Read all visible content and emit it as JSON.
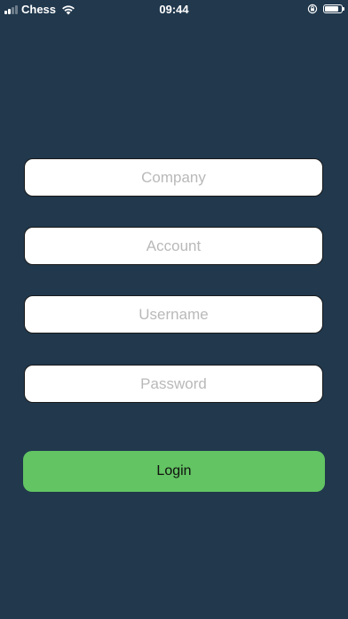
{
  "status_bar": {
    "carrier": "Chess",
    "time": "09:44",
    "battery_level": 0.85,
    "signal_bars_active": 2,
    "signal_bars_total": 4,
    "icons": [
      "signal-icon",
      "wifi-icon",
      "orientation-lock-icon",
      "battery-icon"
    ]
  },
  "form": {
    "company_placeholder": "Company",
    "account_placeholder": "Account",
    "username_placeholder": "Username",
    "password_placeholder": "Password",
    "company_value": "",
    "account_value": "",
    "username_value": "",
    "password_value": ""
  },
  "login": {
    "label": "Login"
  },
  "colors": {
    "background": "#21384d",
    "field_background": "#ffffff",
    "placeholder": "#b9b9b9",
    "login_button": "#62c462",
    "status_text": "#ffffff"
  }
}
